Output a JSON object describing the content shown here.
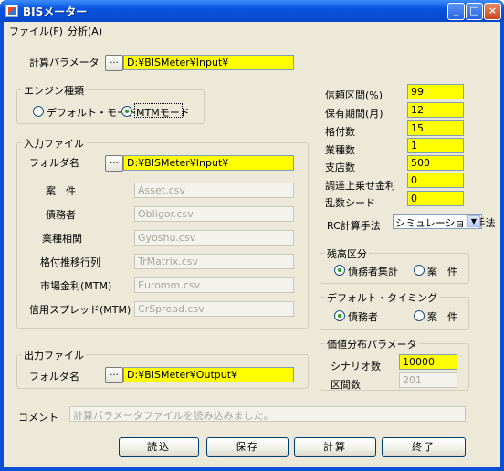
{
  "window": {
    "title": "BISメーター"
  },
  "menu": {
    "file": "ファイル(F)",
    "analysis": "分析(A)"
  },
  "calc_params": {
    "label": "計算パラメータ",
    "browse": "...",
    "path": "D:¥BISMeter¥Input¥"
  },
  "engine": {
    "title": "エンジン種類",
    "options": [
      {
        "label": "デフォルト・モード",
        "selected": false
      },
      {
        "label": "MTMモード",
        "selected": true
      }
    ]
  },
  "input_files": {
    "title": "入力ファイル",
    "folder_label": "フォルダ名",
    "browse": "...",
    "folder_path": "D:¥BISMeter¥Input¥",
    "rows": [
      {
        "label": "案　件",
        "value": "Asset.csv"
      },
      {
        "label": "債務者",
        "value": "Obligor.csv"
      },
      {
        "label": "業種相関",
        "value": "Gyoshu.csv"
      },
      {
        "label": "格付推移行列",
        "value": "TrMatrix.csv"
      },
      {
        "label": "市場金利(MTM)",
        "value": "Euromm.csv"
      },
      {
        "label": "信用スプレッド(MTM)",
        "value": "CrSpread.csv"
      }
    ]
  },
  "params": [
    {
      "label": "信頼区間(%)",
      "value": "99"
    },
    {
      "label": "保有期間(月)",
      "value": "12"
    },
    {
      "label": "格付数",
      "value": "15"
    },
    {
      "label": "業種数",
      "value": "1"
    },
    {
      "label": "支店数",
      "value": "500"
    },
    {
      "label": "調達上乗せ金利",
      "value": "0"
    },
    {
      "label": "乱数シード",
      "value": "0"
    }
  ],
  "rc_method": {
    "label": "RC計算手法",
    "value": "シミュレーション手法"
  },
  "balance": {
    "title": "残高区分",
    "options": [
      {
        "label": "債務者集計",
        "selected": true
      },
      {
        "label": "案　件",
        "selected": false
      }
    ]
  },
  "default_timing": {
    "title": "デフォルト・タイミング",
    "options": [
      {
        "label": "債務者",
        "selected": true
      },
      {
        "label": "案　件",
        "selected": false
      }
    ]
  },
  "value_dist": {
    "title": "価値分布パラメータ",
    "scenario_label": "シナリオ数",
    "scenario_value": "10000",
    "bins_label": "区間数",
    "bins_value": "201"
  },
  "output_files": {
    "title": "出力ファイル",
    "folder_label": "フォルダ名",
    "browse": "...",
    "folder_path": "D:¥BISMeter¥Output¥"
  },
  "comment": {
    "label": "コメント",
    "value": "計算パラメータファイルを読み込みました。"
  },
  "buttons": {
    "load": "読込",
    "save": "保存",
    "calc": "計算",
    "exit": "終了"
  }
}
